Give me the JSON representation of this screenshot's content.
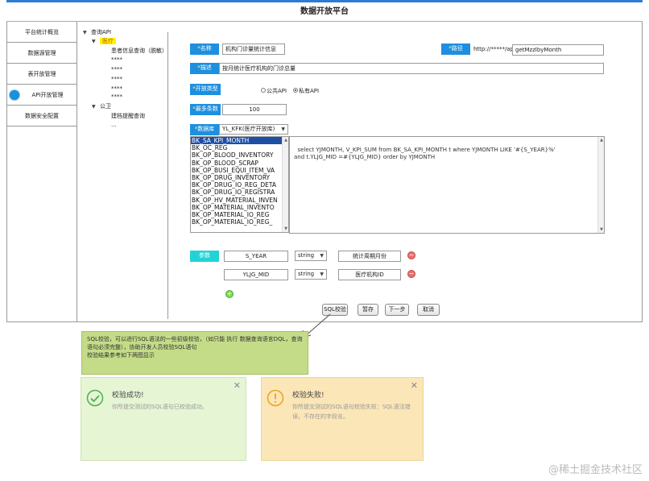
{
  "header": {
    "title": "数据开放平台"
  },
  "sidebar": {
    "items": [
      {
        "label": "平台统计概览"
      },
      {
        "label": "数据源管理"
      },
      {
        "label": "表开放管理"
      },
      {
        "label": "API开放管理"
      },
      {
        "label": "数据安全配置"
      }
    ]
  },
  "tree": {
    "root": "查询API",
    "group1": "医疗",
    "group1_items": [
      "患者信息查询（脱敏）",
      "****",
      "****",
      "****",
      "****",
      "****"
    ],
    "group2": "公卫",
    "group2_items": [
      "建档提醒查询",
      "..."
    ]
  },
  "form": {
    "name_label": "名称",
    "name_value": "机构门诊量统计信息",
    "path_label": "路径",
    "path_prefix": "http://*****/api/",
    "path_value": "getMzzlbyMonth",
    "desc_label": "描述",
    "desc_value": "按月统计医疗机构的门诊总量",
    "open_type_label": "开放类型",
    "open_type_public": "公共API",
    "open_type_private": "私有API",
    "max_label": "最多条数",
    "max_value": "100",
    "db_label": "数据库",
    "db_value": "YL_KFK(医疗开放库)",
    "tables": [
      "BK_SA_KPI_MONTH",
      "BK_OC_REG",
      "BK_OP_BLOOD_INVENTORY",
      "BK_OP_BLOOD_SCRAP",
      "BK_OP_BUSI_EQUI_ITEM_VA",
      "BK_OP_DRUG_INVENTORY",
      "BK_OP_DRUG_IO_REG_DETA",
      "BK_OP_DRUG_IO_REGISTRA",
      "BK_OP_HV_MATERIAL_INVEN",
      "BK_OP_MATERIAL_INVENTO",
      "BK_OP_MATERIAL_IO_REG",
      "BK_OP_MATERIAL_IO_REG_"
    ],
    "sql": "select YJMONTH, V_KPI_SUM from BK_SA_KPI_MONTH t where YJMONTH LIKE '#{S_YEAR}%'\nand t.YLJG_MID =#{YLJG_MID} order by YJMONTH",
    "param_label": "参数",
    "params": [
      {
        "name": "S_YEAR",
        "type": "string",
        "desc": "统计周期月份"
      },
      {
        "name": "YLJG_MID",
        "type": "string",
        "desc": "医疗机构ID"
      }
    ],
    "add_icon": "+",
    "del_icon": "−"
  },
  "buttons": {
    "sql_check": "SQL校验",
    "save": "暂存",
    "next": "下一步",
    "cancel": "取消"
  },
  "note": {
    "text": "SQL校验，可以进行SQL语法的一些初级校验，（如只能 执行 数据查询语言DQL，查询语句必须完整），协助开发人员校验SQL语句\n校验结果参考如下两图显示"
  },
  "success": {
    "title": "校验成功!",
    "msg": "你所提交测试的SQL语句已校验成功。",
    "close": "✕"
  },
  "failure": {
    "title": "校验失败!",
    "msg": "你所提交测试的SQL语句校验失败：SQL语法错误，不存在的字段名。",
    "close": "✕"
  },
  "watermark": "@稀土掘金技术社区",
  "colors": {
    "accent": "#1e8fe0",
    "param_accent": "#22d3d6",
    "note_bg": "#c4dc88",
    "success_bg": "#e6f5d4",
    "failure_bg": "#fbe6b8"
  }
}
